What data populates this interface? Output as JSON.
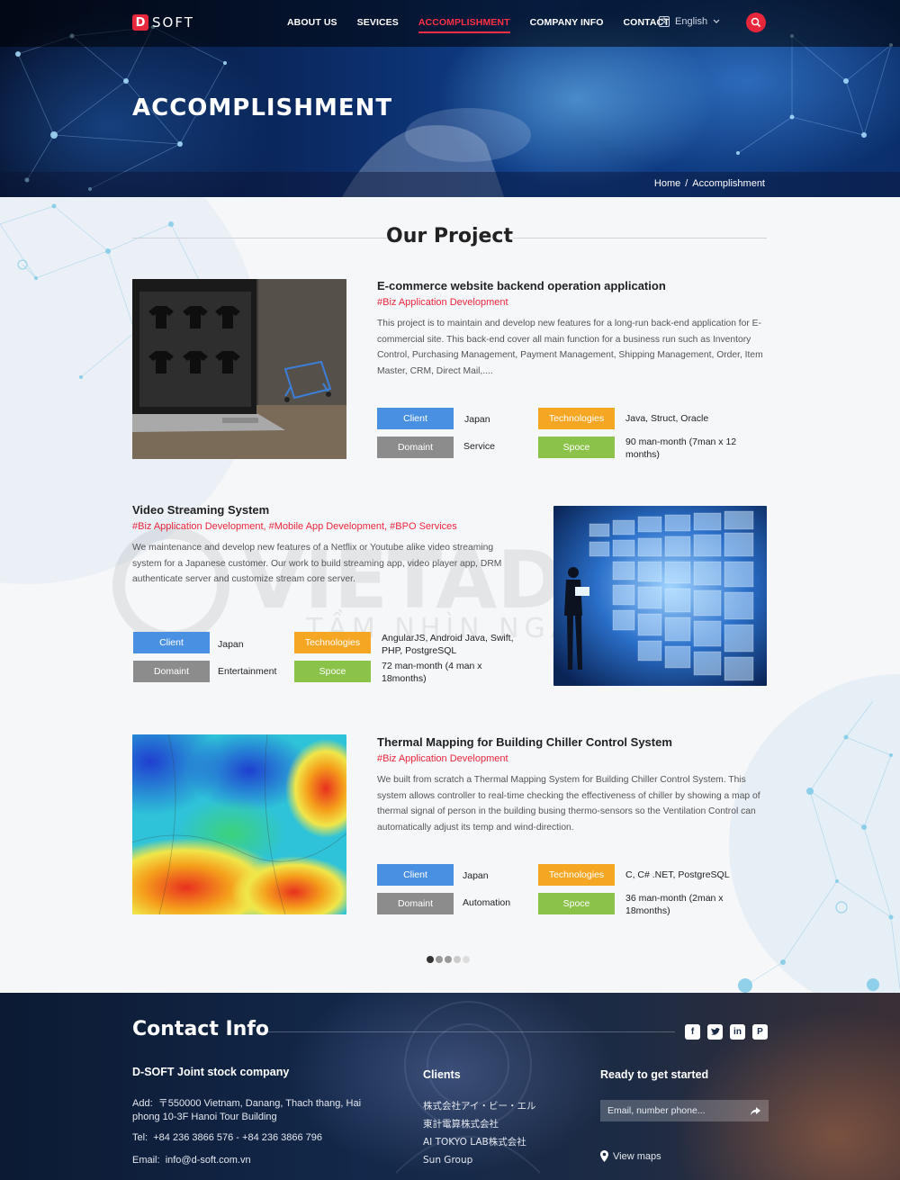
{
  "brand": {
    "logo_letter": "D",
    "logo_text": "SOFT"
  },
  "nav": {
    "items": [
      "ABOUT US",
      "SEVICES",
      "ACCOMPLISHMENT",
      "COMPANY INFO",
      "CONTACT"
    ],
    "active": "ACCOMPLISHMENT"
  },
  "language": {
    "label": "English",
    "icon": "translate-icon"
  },
  "hero": {
    "title": "ACCOMPLISHMENT"
  },
  "breadcrumb": {
    "home": "Home",
    "sep": "/",
    "current": "Accomplishment"
  },
  "section": {
    "title": "Our Project"
  },
  "projects": [
    {
      "title": "E-commerce website backend operation application",
      "tags": "#Biz Application Development",
      "description": "This project is to maintain and develop new features for a long-run back-end application for E-commercial site. This back-end cover all main function for a business run such as Inventory Control, Purchasing Management, Payment Management, Shipping Management, Order, Item Master, CRM, Direct Mail,....",
      "client_label": "Client",
      "client": "Japan",
      "domain_label": "Domaint",
      "domain": "Service",
      "tech_label": "Technologies",
      "tech": "Java, Struct, Oracle",
      "spoce_label": "Spoce",
      "spoce": "90 man-month (7man x 12 months)"
    },
    {
      "title": "Video Streaming System",
      "tags": "#Biz Application Development, #Mobile App Development, #BPO Services",
      "description": "We maintenance and develop new features of a Netflix or Youtube alike video streaming system for a Japanese customer. Our work to build streaming app, video player app, DRM authenticate server and customize stream core server.",
      "client_label": "Client",
      "client": "Japan",
      "domain_label": "Domaint",
      "domain": "Entertainment",
      "tech_label": "Technologies",
      "tech": "AngularJS, Android Java, Swift, PHP, PostgreSQL",
      "spoce_label": "Spoce",
      "spoce": "72 man-month (4 man x 18months)"
    },
    {
      "title": "Thermal Mapping for Building Chiller Control System",
      "tags": "#Biz Application Development",
      "description": "We built from scratch a Thermal Mapping System for Building Chiller Control System. This system allows controller to real-time checking the effectiveness of chiller by showing a map of thermal signal of person in the building busing thermo-sensors so the Ventilation Control can automatically adjust its temp and wind-direction.",
      "client_label": "Client",
      "client": "Japan",
      "domain_label": "Domaint",
      "domain": "Automation",
      "tech_label": "Technologies",
      "tech": "C, C# .NET, PostgreSQL",
      "spoce_label": "Spoce",
      "spoce": "36 man-month (2man x 18months)"
    }
  ],
  "pagination": {
    "count": 5,
    "active": 1
  },
  "footer": {
    "contact_title": "Contact Info",
    "company": "D-SOFT Joint stock company",
    "address_label": "Add:",
    "address": "〒550000 Vietnam, Danang, Thach thang, Hai phong 10-3F Hanoi Tour Building",
    "tel_label": "Tel:",
    "tel": "+84 236 3866 576 - +84 236 3866 796",
    "email_label": "Email:",
    "email": "info@d-soft.com.vn",
    "clients_title": "Clients",
    "clients": [
      "株式会社アイ・ビー・エル",
      "東計電算株式会社",
      "AI TOKYO LAB株式会社",
      "Sun Group"
    ],
    "ready_title": "Ready to get started",
    "email_placeholder": "Email, number phone...",
    "view_maps": "View maps",
    "socials": [
      "facebook-icon",
      "twitter-icon",
      "linkedin-icon",
      "pinterest-icon"
    ]
  },
  "watermark": {
    "brand": "VIETAD",
    "slogan": "TẦM NHÌN NGÀNH"
  },
  "colors": {
    "accent": "#e8263c",
    "client": "#4a90e2",
    "domain": "#8c8c8c",
    "tech": "#f5a623",
    "spoce": "#8bc34a"
  }
}
